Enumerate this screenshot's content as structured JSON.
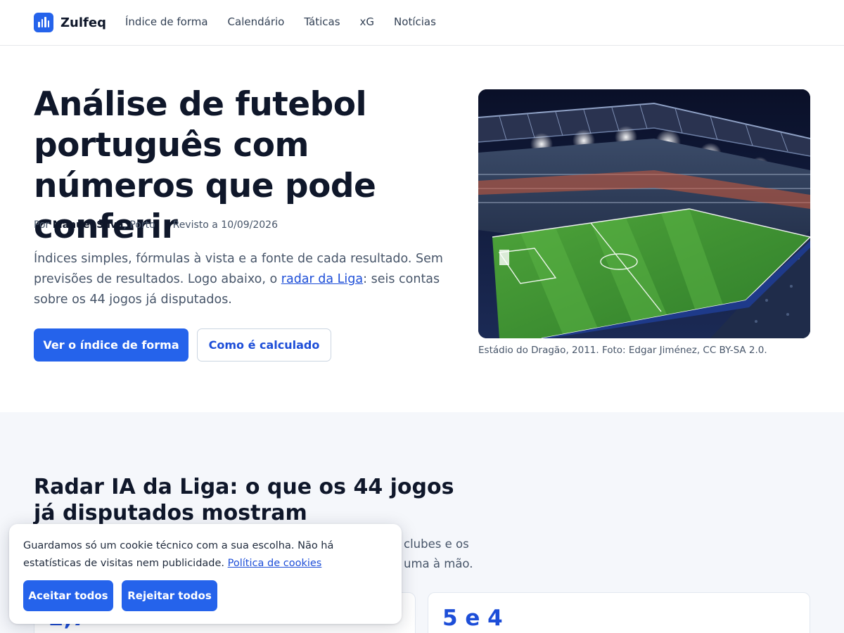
{
  "brand": {
    "name": "Zulfeq",
    "icon": "bar-chart-icon",
    "accent": "#2563eb"
  },
  "nav": [
    "Índice de forma",
    "Calendário",
    "Táticas",
    "xG",
    "Notícias"
  ],
  "hero": {
    "title": "Análise de futebol português com números que pode conferir",
    "byline": {
      "prefix": "Por",
      "author": "Manuel Silva",
      "location": ", Porto",
      "revised": "Revisto a 10/09/2026"
    },
    "lead_before": "Índices simples, fórmulas à vista e a fonte de cada resultado. Sem previsões de resultados. Logo abaixo, o ",
    "lead_link": "radar da Liga",
    "lead_after": ": seis contas sobre os 44 jogos já disputados.",
    "primary_button": "Ver o índice de forma",
    "secondary_button": "Como é calculado",
    "image_caption": "Estádio do Dragão, 2011. Foto: Edgar Jiménez, CC BY-SA 2.0."
  },
  "radar": {
    "title": "Radar IA da Liga: o que os 44 jogos já disputados mostram",
    "lead_visible_1": "clubes e os",
    "lead_visible_2": "uma à mão.",
    "cards": [
      {
        "value": "2,7"
      },
      {
        "value": "5 e 4"
      }
    ]
  },
  "cookie": {
    "text": "Guardamos só um cookie técnico com a sua escolha. Não há estatísticas de visitas nem publicidade. ",
    "link": "Política de cookies",
    "accept": "Aceitar todos",
    "reject": "Rejeitar todos"
  }
}
